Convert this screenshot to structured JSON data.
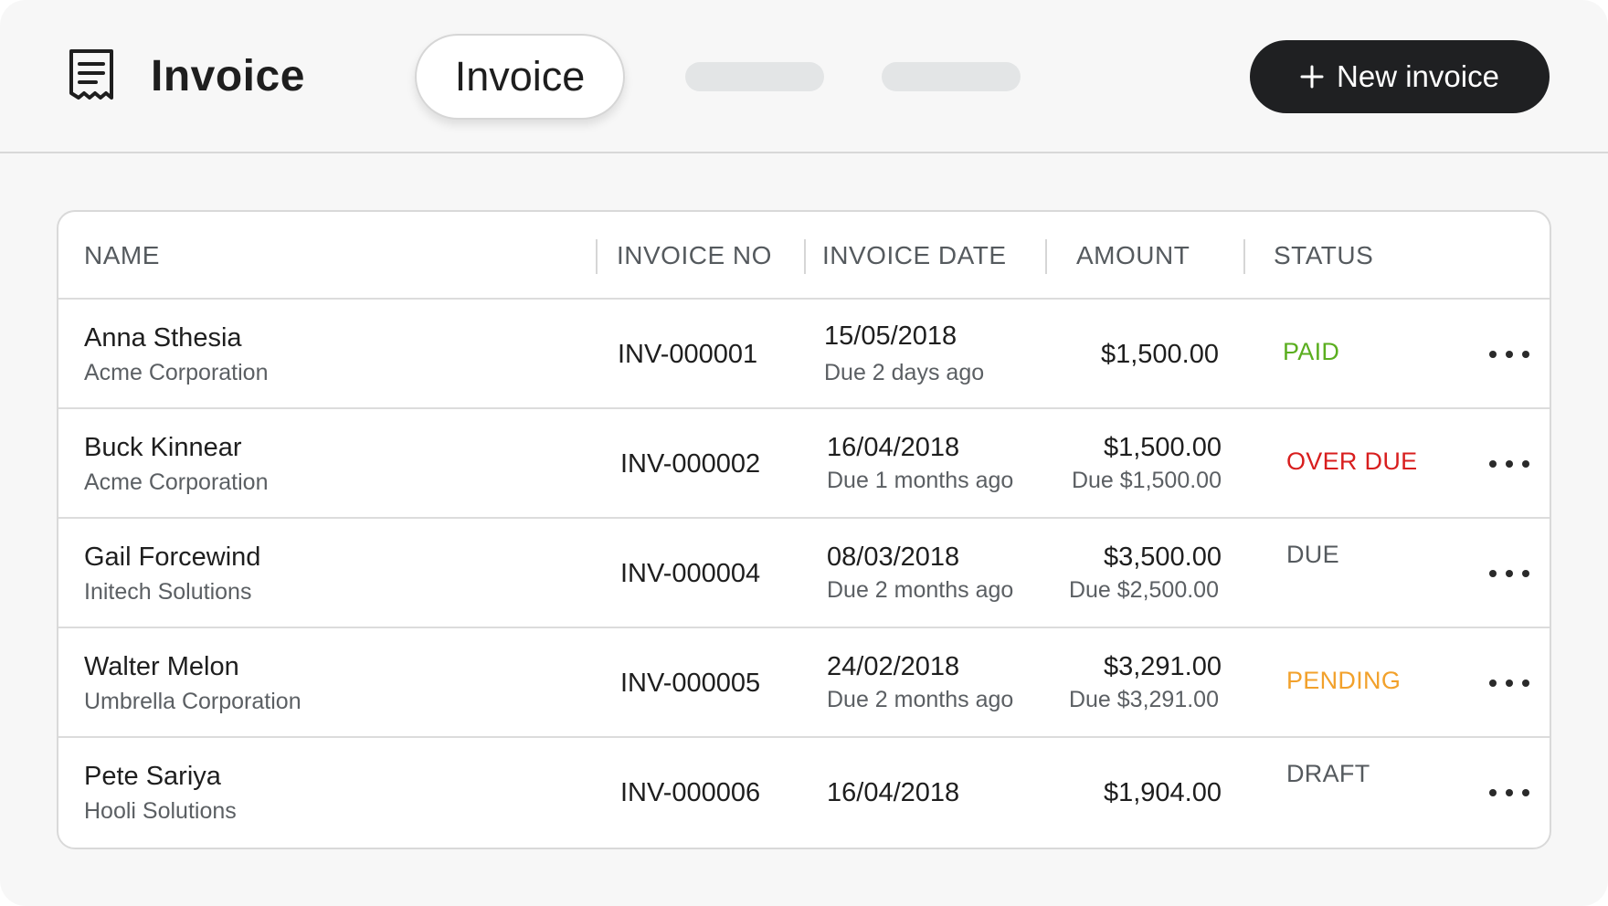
{
  "header": {
    "app_icon": "receipt-icon",
    "title": "Invoice",
    "active_tab": "Invoice",
    "new_button": {
      "icon": "plus-icon",
      "label": "New invoice"
    }
  },
  "table": {
    "columns": [
      "NAME",
      "INVOICE NO",
      "INVOICE DATE",
      "AMOUNT",
      "STATUS"
    ],
    "rows": [
      {
        "name": "Anna Sthesia",
        "company": "Acme Corporation",
        "invoice_no": "INV-000001",
        "date": "15/05/2018",
        "due": "Due 2 days ago",
        "amount": "$1,500.00",
        "amount_due": "",
        "status": "PAID",
        "status_color": "#5aae1f"
      },
      {
        "name": "Buck Kinnear",
        "company": "Acme Corporation",
        "invoice_no": "INV-000002",
        "date": "16/04/2018",
        "due": "Due 1 months ago",
        "amount": "$1,500.00",
        "amount_due": "Due $1,500.00",
        "status": "OVER DUE",
        "status_color": "#d81e1e"
      },
      {
        "name": "Gail Forcewind",
        "company": "Initech Solutions",
        "invoice_no": "INV-000004",
        "date": "08/03/2018",
        "due": "Due 2 months ago",
        "amount": "$3,500.00",
        "amount_due": "Due $2,500.00",
        "status": "DUE",
        "status_color": "#555a5e"
      },
      {
        "name": "Walter Melon",
        "company": "Umbrella Corporation",
        "invoice_no": "INV-000005",
        "date": "24/02/2018",
        "due": "Due 2 months ago",
        "amount": "$3,291.00",
        "amount_due": "Due $3,291.00",
        "status": "PENDING",
        "status_color": "#f2a12b"
      },
      {
        "name": "Pete Sariya",
        "company": "Hooli Solutions",
        "invoice_no": "INV-000006",
        "date": "16/04/2018",
        "due": "",
        "amount": "$1,904.00",
        "amount_due": "",
        "status": "DRAFT",
        "status_color": "#555a5e"
      }
    ],
    "row_action_icon": "more-horizontal-icon"
  }
}
